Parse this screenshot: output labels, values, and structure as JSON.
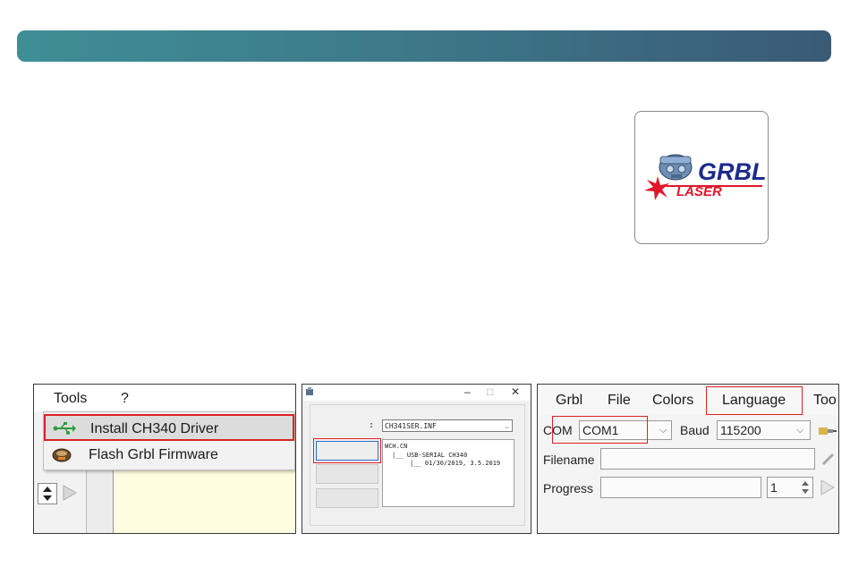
{
  "logo": {
    "word_top": "GRBL",
    "word_bottom": "LASER",
    "colors": {
      "blue": "#1d2a8c",
      "red": "#e0162b",
      "robot": "#6d8fb5"
    }
  },
  "shot1": {
    "menu": [
      "Tools",
      "?"
    ],
    "items": [
      {
        "label": "Install CH340 Driver",
        "icon": "usb-icon",
        "highlighted": true
      },
      {
        "label": "Flash Grbl Firmware",
        "icon": "chip-icon",
        "highlighted": false
      }
    ]
  },
  "shot2": {
    "window_controls": [
      "–",
      "□",
      "✕"
    ],
    "colon": ":",
    "inf_file": "CH341SER.INF",
    "info_lines": [
      "WCH.CN",
      "|__ USB-SERIAL CH340",
      "|__ 01/30/2019, 3.5.2019"
    ]
  },
  "shot3": {
    "menu": [
      "Grbl",
      "File",
      "Colors",
      "Language",
      "Too"
    ],
    "com_label": "COM",
    "com_value": "COM1",
    "baud_label": "Baud",
    "baud_value": "115200",
    "filename_label": "Filename",
    "progress_label": "Progress",
    "progress_count": "1"
  }
}
